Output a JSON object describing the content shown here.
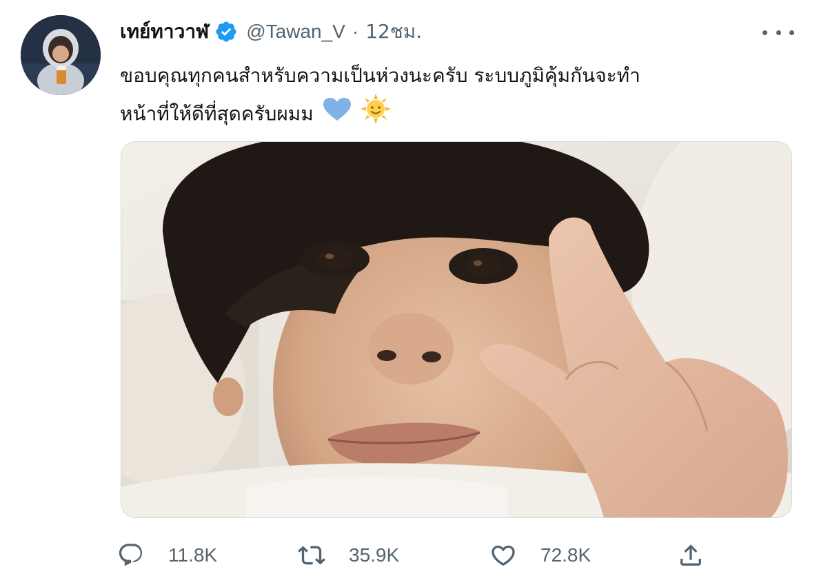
{
  "tweet": {
    "author": {
      "display_name": "เทย์ทาวาฬ",
      "handle": "@Tawan_V",
      "verified": true
    },
    "separator": "·",
    "time": "12ชม.",
    "text_lines": [
      "ขอบคุณทุกคนสำหรับความเป็นห่วงนะครับ ระบบภูมิคุ้มกันจะทำ",
      "หน้าที่ให้ดีที่สุดครับผมม"
    ],
    "emojis": [
      "blue-heart",
      "sun-with-face"
    ],
    "media": {
      "type": "photo",
      "description_icon": "selfie-photo"
    },
    "actions": {
      "reply_count": "11.8K",
      "retweet_count": "35.9K",
      "like_count": "72.8K",
      "share": ""
    }
  },
  "colors": {
    "verified_blue": "#1d9bf0",
    "secondary_text": "#536471",
    "primary_text": "#0f1419",
    "heart_emoji": "#7fb3e8",
    "sun_emoji": "#f5b735"
  }
}
